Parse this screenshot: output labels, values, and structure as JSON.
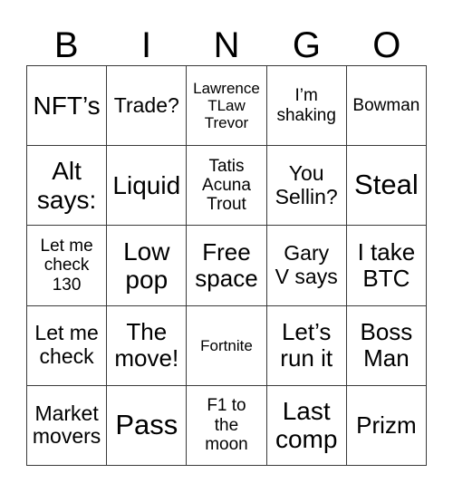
{
  "card": {
    "header_letters": [
      "B",
      "I",
      "N",
      "G",
      "O"
    ],
    "free_space_label": "Free space",
    "rows": [
      [
        {
          "text": "NFT’s",
          "size": "xl"
        },
        {
          "text": "Trade?",
          "size": "md"
        },
        {
          "text": "Lawrence\nTLaw\nTrevor",
          "size": "xs"
        },
        {
          "text": "I’m\nshaking",
          "size": "sm"
        },
        {
          "text": "Bowman",
          "size": "sm"
        }
      ],
      [
        {
          "text": "Alt\nsays:",
          "size": "xl"
        },
        {
          "text": "Liquid",
          "size": "xl"
        },
        {
          "text": "Tatis\nAcuna\nTrout",
          "size": "sm"
        },
        {
          "text": "You\nSellin?",
          "size": "md"
        },
        {
          "text": "Steal",
          "size": "xxl"
        }
      ],
      [
        {
          "text": "Let me\ncheck\n130",
          "size": "sm"
        },
        {
          "text": "Low\npop",
          "size": "xl"
        },
        {
          "text": "Free\nspace",
          "size": "lg"
        },
        {
          "text": "Gary\nV says",
          "size": "md"
        },
        {
          "text": "I take\nBTC",
          "size": "lg"
        }
      ],
      [
        {
          "text": "Let me\ncheck",
          "size": "md"
        },
        {
          "text": "The\nmove!",
          "size": "lg"
        },
        {
          "text": "Fortnite",
          "size": "xs"
        },
        {
          "text": "Let’s\nrun it",
          "size": "lg"
        },
        {
          "text": "Boss\nMan",
          "size": "lg"
        }
      ],
      [
        {
          "text": "Market\nmovers",
          "size": "md"
        },
        {
          "text": "Pass",
          "size": "xxl"
        },
        {
          "text": "F1 to\nthe\nmoon",
          "size": "sm"
        },
        {
          "text": "Last\ncomp",
          "size": "xl"
        },
        {
          "text": "Prizm",
          "size": "lg"
        }
      ]
    ]
  },
  "colors": {
    "background": "#ffffff",
    "grid_line": "#3a3a3a",
    "text": "#000000"
  }
}
